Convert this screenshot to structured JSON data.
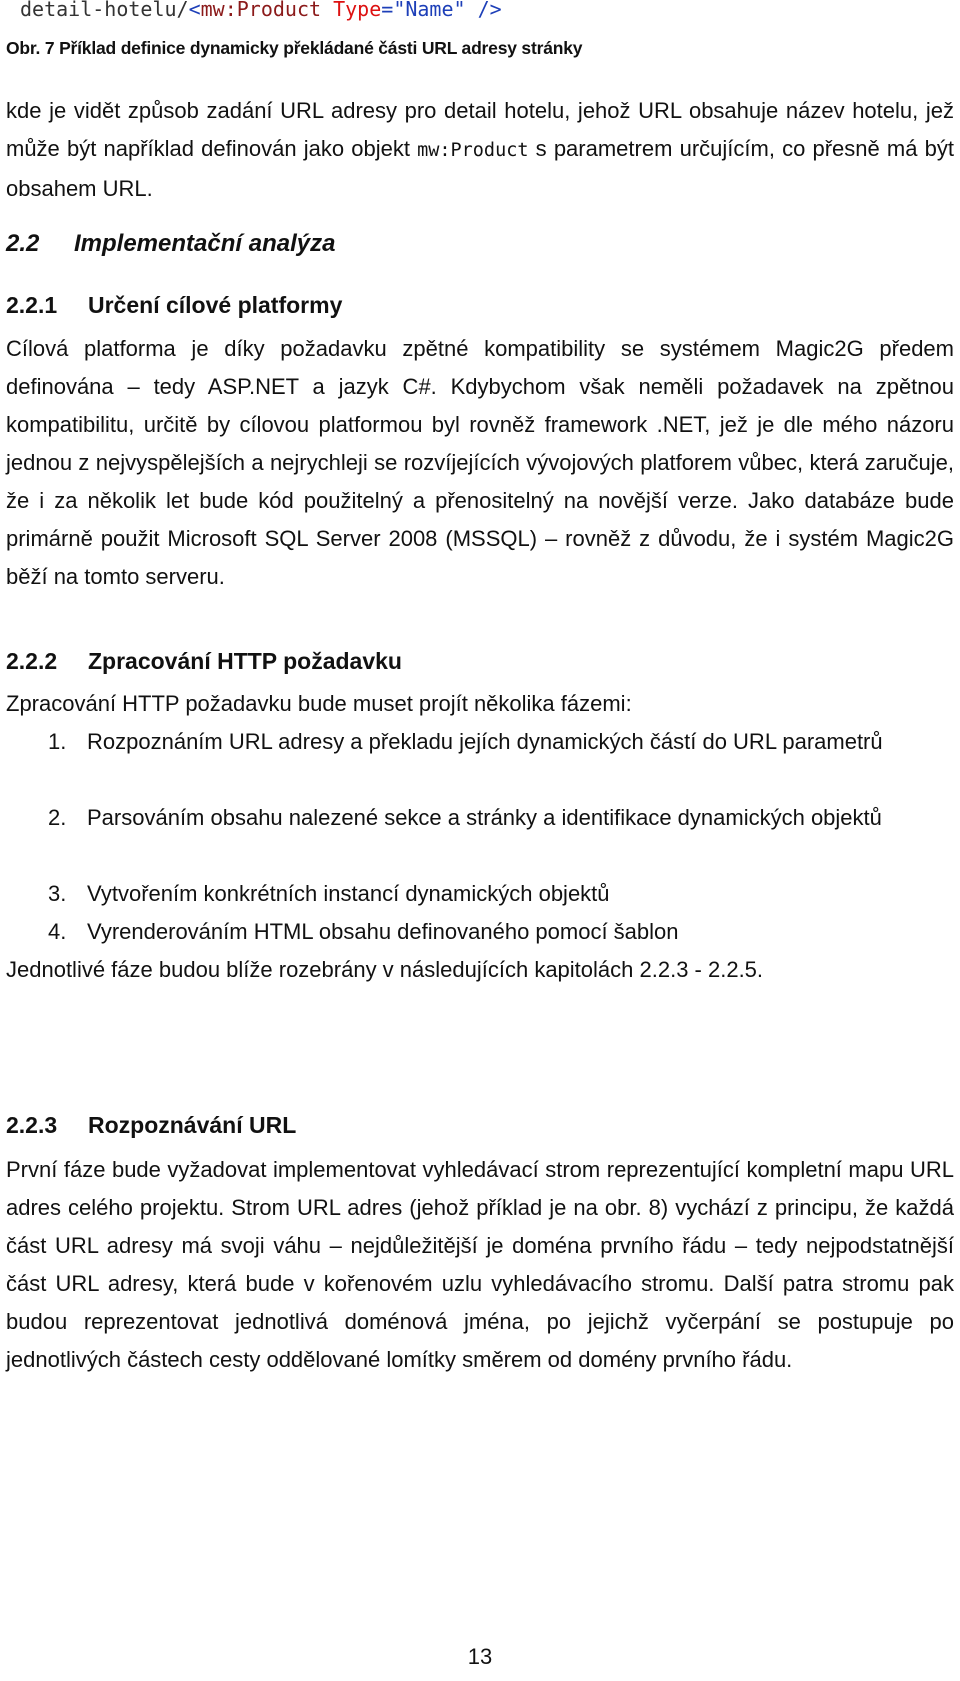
{
  "code_snippet": {
    "prefix": "detail-hotelu/",
    "open_bracket": "<",
    "element": "mw:Product",
    "attribute": "Type",
    "equals": "=",
    "value": "\"Name\"",
    "close": " />"
  },
  "figure_caption": "Obr. 7 Příklad definice dynamicky překládané části URL adresy stránky",
  "intro_paragraph": {
    "text_before": "kde je vidět způsob zadání URL adresy pro detail hotelu, jehož URL obsahuje název hotelu, jež může být například definován jako objekt ",
    "code": "mw:Product",
    "text_after": " s parametrem určujícím, co přesně má být obsahem URL."
  },
  "section_2_2": {
    "number": "2.2",
    "title": "Implementační analýza"
  },
  "section_2_2_1": {
    "number": "2.2.1",
    "title": "Určení cílové platformy",
    "paragraph": "Cílová platforma je díky požadavku zpětné kompatibility se systémem Magic2G předem definována – tedy ASP.NET a jazyk C#. Kdybychom však neměli požadavek na zpětnou kompatibilitu, určitě by cílovou platformou byl rovněž framework .NET, jež je dle mého názoru jednou z nejvyspělejších a nejrychleji se rozvíjejících vývojových platforem vůbec, která zaručuje, že i za několik let bude kód použitelný a přenositelný na novější verze. Jako databáze bude primárně použit Microsoft SQL Server 2008 (MSSQL) – rovněž z důvodu, že i systém Magic2G běží na tomto serveru."
  },
  "section_2_2_2": {
    "number": "2.2.2",
    "title": "Zpracování HTTP požadavku",
    "intro": "Zpracování HTTP požadavku bude muset projít několika fázemi:",
    "steps": [
      {
        "n": "1.",
        "text": "Rozpoznáním URL adresy a překladu jejích dynamických částí do URL parametrů"
      },
      {
        "n": "2.",
        "text": "Parsováním obsahu nalezené sekce a stránky a identifikace dynamických objektů"
      },
      {
        "n": "3.",
        "text": "Vytvořením konkrétních instancí dynamických objektů"
      },
      {
        "n": "4.",
        "text": "Vyrenderováním HTML obsahu definovaného pomocí šablon"
      }
    ],
    "outro": "Jednotlivé fáze budou blíže rozebrány v následujících kapitolách 2.2.3 - 2.2.5."
  },
  "section_2_2_3": {
    "number": "2.2.3",
    "title": "Rozpoznávání URL",
    "paragraph": "První fáze bude vyžadovat implementovat vyhledávací strom reprezentující kompletní mapu URL adres celého projektu. Strom URL adres (jehož příklad je na obr. 8) vychází z principu, že každá část URL adresy má svoji váhu – nejdůležitější je doména prvního řádu – tedy nejpodstatnější část URL adresy, která bude v kořenovém uzlu vyhledávacího stromu. Další patra stromu pak budou reprezentovat jednotlivá doménová jména, po jejichž vyčerpání se postupuje po jednotlivých částech cesty oddělované lomítky směrem od domény prvního řádu."
  },
  "page_number": "13"
}
